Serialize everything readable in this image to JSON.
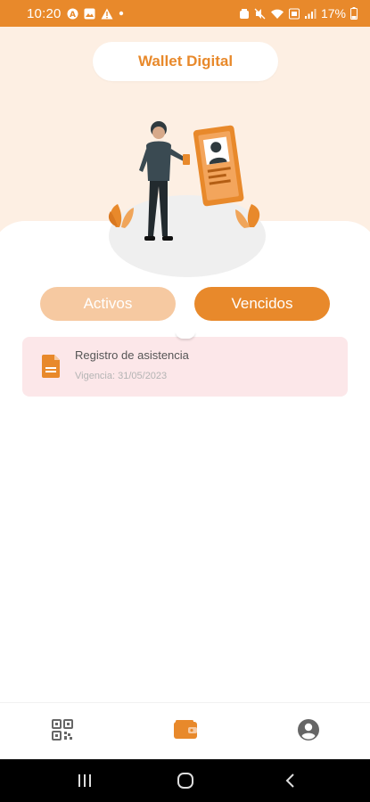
{
  "status_bar": {
    "time": "10:20",
    "battery": "17%"
  },
  "header": {
    "title": "Wallet Digital"
  },
  "tabs": {
    "active_label": "Activos",
    "expired_label": "Vencidos"
  },
  "documents": [
    {
      "title": "Registro de asistencia",
      "subtitle": "Vigencia: 31/05/2023"
    }
  ],
  "bottom_nav": [
    {
      "icon": "qr-code-icon"
    },
    {
      "icon": "wallet-icon",
      "selected": true
    },
    {
      "icon": "account-circle-icon"
    }
  ],
  "colors": {
    "accent": "#E8892B",
    "accent_light": "#F6C9A1",
    "hero_bg": "#FDEFE3",
    "card_bg": "#FCE7E9"
  }
}
